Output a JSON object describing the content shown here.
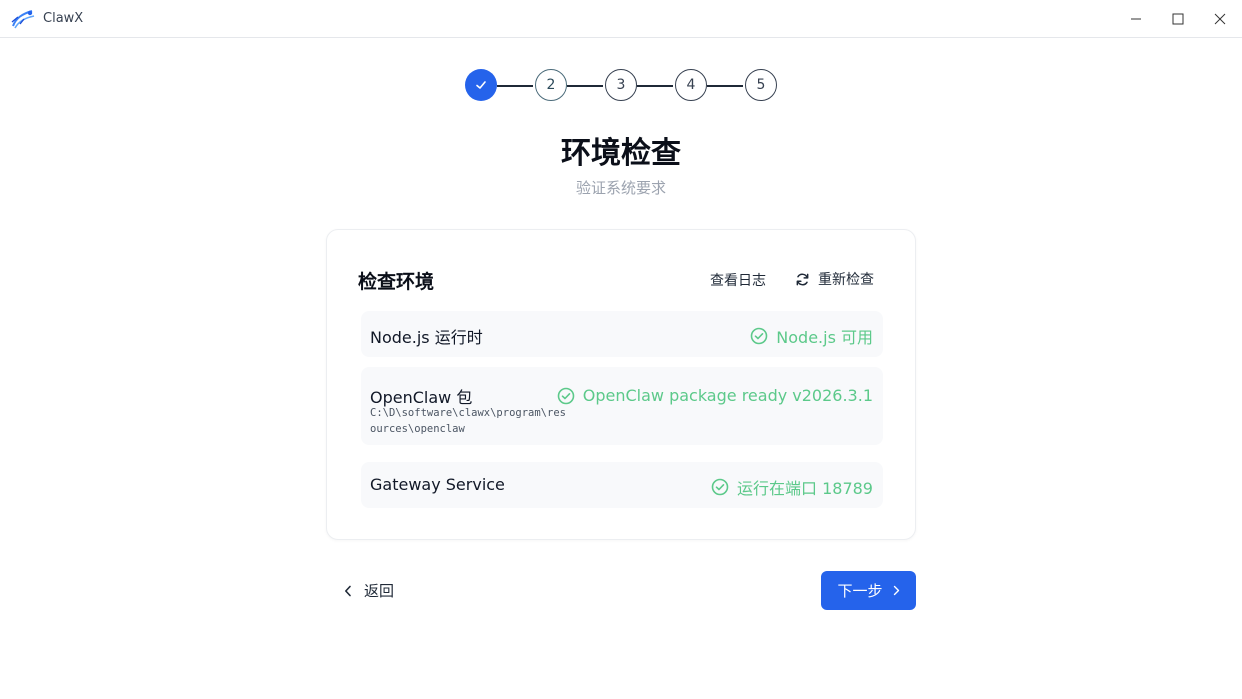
{
  "window": {
    "title": "ClawX"
  },
  "stepper": {
    "steps": [
      {
        "label": "",
        "state": "done"
      },
      {
        "label": "2",
        "state": "current"
      },
      {
        "label": "3",
        "state": "pending"
      },
      {
        "label": "4",
        "state": "pending"
      },
      {
        "label": "5",
        "state": "pending"
      }
    ]
  },
  "page": {
    "title": "环境检查",
    "subtitle": "验证系统要求"
  },
  "card": {
    "title": "检查环境",
    "view_log_label": "查看日志",
    "recheck_label": "重新检查",
    "checks": [
      {
        "label": "Node.js 运行时",
        "detail": "",
        "status": "Node.js 可用"
      },
      {
        "label": "OpenClaw 包",
        "detail": "C:\\D\\software\\clawx\\program\\resources\\openclaw",
        "status": "OpenClaw package ready v2026.3.1"
      },
      {
        "label": "Gateway Service",
        "detail": "",
        "status": "运行在端口 18789"
      }
    ]
  },
  "footer": {
    "back_label": "返回",
    "next_label": "下一步"
  },
  "colors": {
    "accent": "#2563eb",
    "success": "#5cc98a"
  },
  "icons": {
    "done_step": "check-icon",
    "recheck": "refresh-icon",
    "status": "check-circle-icon",
    "back": "chevron-left-icon",
    "next": "chevron-right-icon"
  }
}
